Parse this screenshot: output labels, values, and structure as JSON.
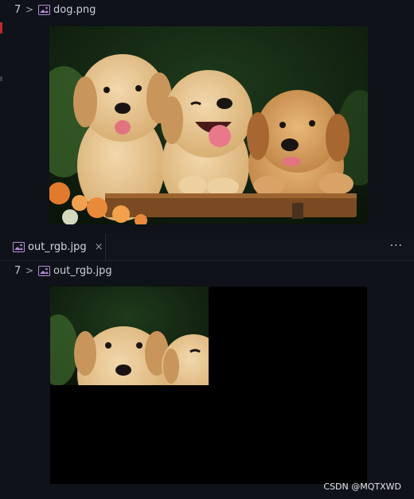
{
  "top_editor": {
    "breadcrumb": {
      "number": "7",
      "separator": ">",
      "filename": "dog.png"
    }
  },
  "bottom_editor": {
    "tab": {
      "label": "out_rgb.jpg",
      "close": "×"
    },
    "more": "···",
    "breadcrumb": {
      "number": "7",
      "separator": ">",
      "filename": "out_rgb.jpg"
    }
  },
  "watermark": "CSDN @MQTXWD",
  "colors": {
    "background": "#0f1219",
    "accent_marker": "#c1272d",
    "image_icon": "#b58bd6"
  }
}
